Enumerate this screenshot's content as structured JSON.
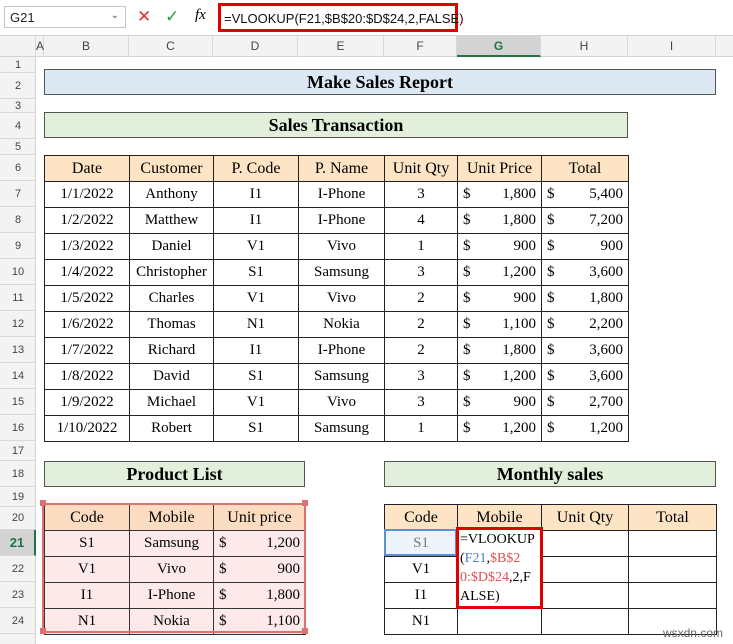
{
  "formula_bar": {
    "name_box": "G21",
    "formula": "=VLOOKUP(F21,$B$20:$D$24,2,FALSE)",
    "fx": "fx"
  },
  "columns": [
    "A",
    "B",
    "C",
    "D",
    "E",
    "F",
    "G",
    "H",
    "I"
  ],
  "rows": [
    "1",
    "2",
    "3",
    "4",
    "5",
    "6",
    "7",
    "8",
    "9",
    "10",
    "11",
    "12",
    "13",
    "14",
    "15",
    "16",
    "17",
    "18",
    "19",
    "20",
    "21",
    "22",
    "23",
    "24"
  ],
  "report_title": "Make Sales Report",
  "transaction_title": "Sales Transaction",
  "transactions": {
    "headers": [
      "Date",
      "Customer",
      "P. Code",
      "P. Name",
      "Unit Qty",
      "Unit Price",
      "Total"
    ],
    "rows": [
      [
        "1/1/2022",
        "Anthony",
        "I1",
        "I-Phone",
        "3",
        "1,800",
        "5,400"
      ],
      [
        "1/2/2022",
        "Matthew",
        "I1",
        "I-Phone",
        "4",
        "1,800",
        "7,200"
      ],
      [
        "1/3/2022",
        "Daniel",
        "V1",
        "Vivo",
        "1",
        "900",
        "900"
      ],
      [
        "1/4/2022",
        "Christopher",
        "S1",
        "Samsung",
        "3",
        "1,200",
        "3,600"
      ],
      [
        "1/5/2022",
        "Charles",
        "V1",
        "Vivo",
        "2",
        "900",
        "1,800"
      ],
      [
        "1/6/2022",
        "Thomas",
        "N1",
        "Nokia",
        "2",
        "1,100",
        "2,200"
      ],
      [
        "1/7/2022",
        "Richard",
        "I1",
        "I-Phone",
        "2",
        "1,800",
        "3,600"
      ],
      [
        "1/8/2022",
        "David",
        "S1",
        "Samsung",
        "3",
        "1,200",
        "3,600"
      ],
      [
        "1/9/2022",
        "Michael",
        "V1",
        "Vivo",
        "3",
        "900",
        "2,700"
      ],
      [
        "1/10/2022",
        "Robert",
        "S1",
        "Samsung",
        "1",
        "1,200",
        "1,200"
      ]
    ]
  },
  "currency": "$",
  "product_title": "Product List",
  "products": {
    "headers": [
      "Code",
      "Mobile",
      "Unit price"
    ],
    "rows": [
      [
        "S1",
        "Samsung",
        "1,200"
      ],
      [
        "V1",
        "Vivo",
        "900"
      ],
      [
        "I1",
        "I-Phone",
        "1,800"
      ],
      [
        "N1",
        "Nokia",
        "1,100"
      ]
    ]
  },
  "monthly_title": "Monthly sales",
  "monthly": {
    "headers": [
      "Code",
      "Mobile",
      "Unit Qty",
      "Total"
    ],
    "codes": [
      "S1",
      "V1",
      "I1",
      "N1"
    ],
    "edit": {
      "p1": "=VLOOKUP(",
      "p2": "F21",
      ",": ",",
      "p3": "$B$20:$D$24",
      "p4": ",2,FALSE)"
    }
  },
  "watermark": "wsxdn.com"
}
